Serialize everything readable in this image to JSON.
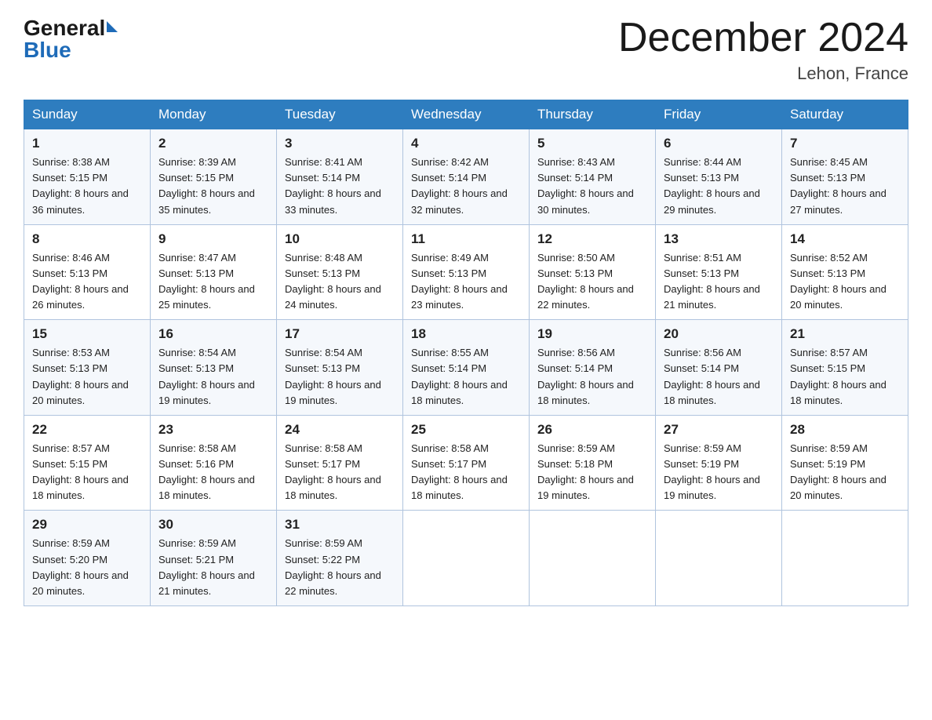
{
  "header": {
    "logo_general": "General",
    "logo_blue": "Blue",
    "title": "December 2024",
    "location": "Lehon, France"
  },
  "columns": [
    "Sunday",
    "Monday",
    "Tuesday",
    "Wednesday",
    "Thursday",
    "Friday",
    "Saturday"
  ],
  "weeks": [
    [
      {
        "day": "1",
        "sunrise": "8:38 AM",
        "sunset": "5:15 PM",
        "daylight": "8 hours and 36 minutes."
      },
      {
        "day": "2",
        "sunrise": "8:39 AM",
        "sunset": "5:15 PM",
        "daylight": "8 hours and 35 minutes."
      },
      {
        "day": "3",
        "sunrise": "8:41 AM",
        "sunset": "5:14 PM",
        "daylight": "8 hours and 33 minutes."
      },
      {
        "day": "4",
        "sunrise": "8:42 AM",
        "sunset": "5:14 PM",
        "daylight": "8 hours and 32 minutes."
      },
      {
        "day": "5",
        "sunrise": "8:43 AM",
        "sunset": "5:14 PM",
        "daylight": "8 hours and 30 minutes."
      },
      {
        "day": "6",
        "sunrise": "8:44 AM",
        "sunset": "5:13 PM",
        "daylight": "8 hours and 29 minutes."
      },
      {
        "day": "7",
        "sunrise": "8:45 AM",
        "sunset": "5:13 PM",
        "daylight": "8 hours and 27 minutes."
      }
    ],
    [
      {
        "day": "8",
        "sunrise": "8:46 AM",
        "sunset": "5:13 PM",
        "daylight": "8 hours and 26 minutes."
      },
      {
        "day": "9",
        "sunrise": "8:47 AM",
        "sunset": "5:13 PM",
        "daylight": "8 hours and 25 minutes."
      },
      {
        "day": "10",
        "sunrise": "8:48 AM",
        "sunset": "5:13 PM",
        "daylight": "8 hours and 24 minutes."
      },
      {
        "day": "11",
        "sunrise": "8:49 AM",
        "sunset": "5:13 PM",
        "daylight": "8 hours and 23 minutes."
      },
      {
        "day": "12",
        "sunrise": "8:50 AM",
        "sunset": "5:13 PM",
        "daylight": "8 hours and 22 minutes."
      },
      {
        "day": "13",
        "sunrise": "8:51 AM",
        "sunset": "5:13 PM",
        "daylight": "8 hours and 21 minutes."
      },
      {
        "day": "14",
        "sunrise": "8:52 AM",
        "sunset": "5:13 PM",
        "daylight": "8 hours and 20 minutes."
      }
    ],
    [
      {
        "day": "15",
        "sunrise": "8:53 AM",
        "sunset": "5:13 PM",
        "daylight": "8 hours and 20 minutes."
      },
      {
        "day": "16",
        "sunrise": "8:54 AM",
        "sunset": "5:13 PM",
        "daylight": "8 hours and 19 minutes."
      },
      {
        "day": "17",
        "sunrise": "8:54 AM",
        "sunset": "5:13 PM",
        "daylight": "8 hours and 19 minutes."
      },
      {
        "day": "18",
        "sunrise": "8:55 AM",
        "sunset": "5:14 PM",
        "daylight": "8 hours and 18 minutes."
      },
      {
        "day": "19",
        "sunrise": "8:56 AM",
        "sunset": "5:14 PM",
        "daylight": "8 hours and 18 minutes."
      },
      {
        "day": "20",
        "sunrise": "8:56 AM",
        "sunset": "5:14 PM",
        "daylight": "8 hours and 18 minutes."
      },
      {
        "day": "21",
        "sunrise": "8:57 AM",
        "sunset": "5:15 PM",
        "daylight": "8 hours and 18 minutes."
      }
    ],
    [
      {
        "day": "22",
        "sunrise": "8:57 AM",
        "sunset": "5:15 PM",
        "daylight": "8 hours and 18 minutes."
      },
      {
        "day": "23",
        "sunrise": "8:58 AM",
        "sunset": "5:16 PM",
        "daylight": "8 hours and 18 minutes."
      },
      {
        "day": "24",
        "sunrise": "8:58 AM",
        "sunset": "5:17 PM",
        "daylight": "8 hours and 18 minutes."
      },
      {
        "day": "25",
        "sunrise": "8:58 AM",
        "sunset": "5:17 PM",
        "daylight": "8 hours and 18 minutes."
      },
      {
        "day": "26",
        "sunrise": "8:59 AM",
        "sunset": "5:18 PM",
        "daylight": "8 hours and 19 minutes."
      },
      {
        "day": "27",
        "sunrise": "8:59 AM",
        "sunset": "5:19 PM",
        "daylight": "8 hours and 19 minutes."
      },
      {
        "day": "28",
        "sunrise": "8:59 AM",
        "sunset": "5:19 PM",
        "daylight": "8 hours and 20 minutes."
      }
    ],
    [
      {
        "day": "29",
        "sunrise": "8:59 AM",
        "sunset": "5:20 PM",
        "daylight": "8 hours and 20 minutes."
      },
      {
        "day": "30",
        "sunrise": "8:59 AM",
        "sunset": "5:21 PM",
        "daylight": "8 hours and 21 minutes."
      },
      {
        "day": "31",
        "sunrise": "8:59 AM",
        "sunset": "5:22 PM",
        "daylight": "8 hours and 22 minutes."
      },
      null,
      null,
      null,
      null
    ]
  ]
}
